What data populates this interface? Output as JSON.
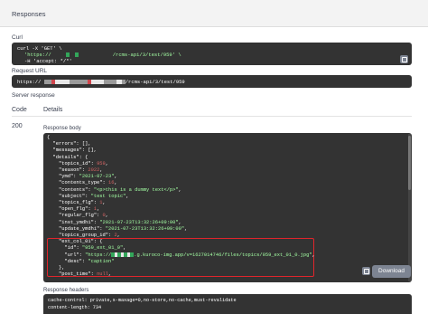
{
  "header": {
    "title": "Responses"
  },
  "curl": {
    "label": "Curl",
    "line1": "curl -X 'GET' \\",
    "line2_prefix": "'https://",
    "line2_suffix": "/rcms-api/3/test/959' \\",
    "line3": "-H 'accept: */*'"
  },
  "request_url": {
    "label": "Request URL",
    "prefix": "https://",
    "suffix": "/rcms-api/3/test/959"
  },
  "server_response": {
    "label": "Server response",
    "col_code": "Code",
    "col_details": "Details",
    "code": "200",
    "body_label": "Response body"
  },
  "json_lines": [
    {
      "indent": 0,
      "parts": [
        {
          "t": "{",
          "c": "p"
        }
      ]
    },
    {
      "indent": 1,
      "parts": [
        {
          "t": "\"errors\": [],",
          "c": "k"
        }
      ]
    },
    {
      "indent": 1,
      "parts": [
        {
          "t": "\"messages\": [],",
          "c": "k"
        }
      ]
    },
    {
      "indent": 1,
      "parts": [
        {
          "t": "\"details\": {",
          "c": "k"
        }
      ]
    },
    {
      "indent": 2,
      "parts": [
        {
          "t": "\"topics_id\": ",
          "c": "k"
        },
        {
          "t": "959",
          "c": "n"
        },
        {
          "t": ",",
          "c": "p"
        }
      ]
    },
    {
      "indent": 2,
      "parts": [
        {
          "t": "\"season\": ",
          "c": "k"
        },
        {
          "t": "2022",
          "c": "n"
        },
        {
          "t": ",",
          "c": "p"
        }
      ]
    },
    {
      "indent": 2,
      "parts": [
        {
          "t": "\"ymd\": ",
          "c": "k"
        },
        {
          "t": "\"2021-07-23\"",
          "c": "s"
        },
        {
          "t": ",",
          "c": "p"
        }
      ]
    },
    {
      "indent": 2,
      "parts": [
        {
          "t": "\"contents_type\": ",
          "c": "k"
        },
        {
          "t": "16",
          "c": "n"
        },
        {
          "t": ",",
          "c": "p"
        }
      ]
    },
    {
      "indent": 2,
      "parts": [
        {
          "t": "\"contents\": ",
          "c": "k"
        },
        {
          "t": "\"<p>this is a dummy text</p>\"",
          "c": "s"
        },
        {
          "t": ",",
          "c": "p"
        }
      ]
    },
    {
      "indent": 2,
      "parts": [
        {
          "t": "\"subject\": ",
          "c": "k"
        },
        {
          "t": "\"test topic\"",
          "c": "s"
        },
        {
          "t": ",",
          "c": "p"
        }
      ]
    },
    {
      "indent": 2,
      "parts": [
        {
          "t": "\"topics_flg\": ",
          "c": "k"
        },
        {
          "t": "1",
          "c": "n"
        },
        {
          "t": ",",
          "c": "p"
        }
      ]
    },
    {
      "indent": 2,
      "parts": [
        {
          "t": "\"open_flg\": ",
          "c": "k"
        },
        {
          "t": "1",
          "c": "n"
        },
        {
          "t": ",",
          "c": "p"
        }
      ]
    },
    {
      "indent": 2,
      "parts": [
        {
          "t": "\"regular_flg\": ",
          "c": "k"
        },
        {
          "t": "0",
          "c": "n"
        },
        {
          "t": ",",
          "c": "p"
        }
      ]
    },
    {
      "indent": 2,
      "parts": [
        {
          "t": "\"inst_ymdhi\": ",
          "c": "k"
        },
        {
          "t": "\"2021-07-23T13:32:26+09:00\"",
          "c": "s"
        },
        {
          "t": ",",
          "c": "p"
        }
      ]
    },
    {
      "indent": 2,
      "parts": [
        {
          "t": "\"update_ymdhi\": ",
          "c": "k"
        },
        {
          "t": "\"2021-07-23T13:32:26+09:00\"",
          "c": "s"
        },
        {
          "t": ",",
          "c": "p"
        }
      ]
    },
    {
      "indent": 2,
      "parts": [
        {
          "t": "\"topics_group_id\": ",
          "c": "k"
        },
        {
          "t": "2",
          "c": "n"
        },
        {
          "t": ",",
          "c": "p"
        }
      ]
    },
    {
      "indent": 2,
      "parts": [
        {
          "t": "\"ext_col_01\": {",
          "c": "k"
        }
      ]
    },
    {
      "indent": 3,
      "parts": [
        {
          "t": "\"id\": ",
          "c": "k"
        },
        {
          "t": "\"959_ext_01_0\"",
          "c": "s"
        },
        {
          "t": ",",
          "c": "p"
        }
      ]
    },
    {
      "indent": 3,
      "parts": [
        {
          "t": "\"url\": ",
          "c": "k"
        },
        {
          "t": "\"https://",
          "c": "s"
        },
        {
          "t": "REDACT",
          "c": "r"
        },
        {
          "t": ".g.kuroco-img.app/v=1627014746/files/topics/959_ext_01_0.jpg\"",
          "c": "s"
        },
        {
          "t": ",",
          "c": "p"
        }
      ]
    },
    {
      "indent": 3,
      "parts": [
        {
          "t": "\"desc\": ",
          "c": "k"
        },
        {
          "t": "\"caption\"",
          "c": "s"
        }
      ]
    },
    {
      "indent": 2,
      "parts": [
        {
          "t": "},",
          "c": "p"
        }
      ]
    },
    {
      "indent": 2,
      "parts": [
        {
          "t": "\"post_time\": ",
          "c": "k"
        },
        {
          "t": "null",
          "c": "n"
        },
        {
          "t": ",",
          "c": "p"
        }
      ]
    }
  ],
  "download_label": "Download",
  "headers": {
    "label": "Response headers",
    "line1": "cache-control: private,s-maxage=0,no-store,no-cache,must-revalidate",
    "line2": "content-length: 734"
  },
  "colors": {
    "code_bg": "#333333",
    "string": "#a2fca2",
    "number": "#d36363",
    "highlight": "#e0252c"
  }
}
